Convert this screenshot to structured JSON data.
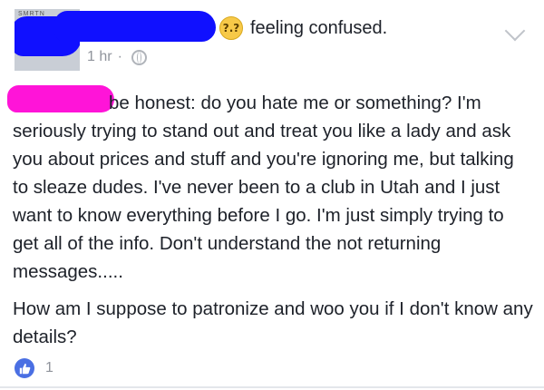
{
  "post": {
    "avatar_tag": "SMRTN",
    "feeling": {
      "icon": "confused-face-icon",
      "label": "feeling confused."
    },
    "timestamp": "1 hr",
    "separator": "·",
    "privacy_icon": "globe-icon",
    "paragraphs": [
      "be honest: do you hate me or something? I'm seriously trying to stand out and treat you like a lady and ask you about prices and stuff and you're ignoring me, but talking to sleaze dudes. I've never been to a club in Utah and I just want to know everything before I go. I'm just simply trying to get all of the info. Don't understand the not returning messages.....",
      "How am I suppose to patronize and woo you if I don't know any details?"
    ],
    "reactions": {
      "icon": "like-thumb-icon",
      "count": "1"
    }
  },
  "colors": {
    "redaction_blue": "#1010ff",
    "redaction_pink": "#ff14d8",
    "like_blue": "#4a6fe3",
    "meta_gray": "#90949c"
  }
}
